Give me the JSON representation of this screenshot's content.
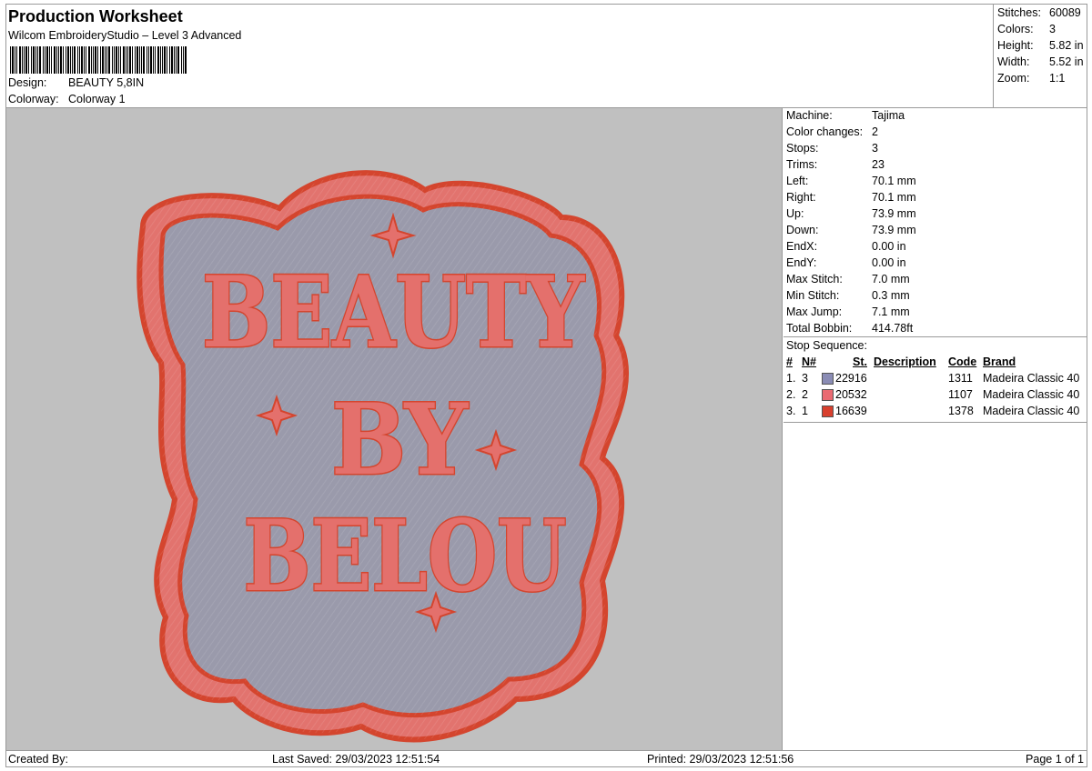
{
  "header": {
    "title": "Production Worksheet",
    "subtitle": "Wilcom EmbroideryStudio – Level 3 Advanced",
    "design_label": "Design:",
    "design_value": "BEAUTY 5,8IN",
    "colorway_label": "Colorway:",
    "colorway_value": "Colorway 1"
  },
  "stats": [
    {
      "label": "Stitches:",
      "value": "60089"
    },
    {
      "label": "Colors:",
      "value": "3"
    },
    {
      "label": "Height:",
      "value": "5.82 in"
    },
    {
      "label": "Width:",
      "value": "5.52 in"
    },
    {
      "label": "Zoom:",
      "value": "1:1"
    }
  ],
  "machine_info": [
    {
      "label": "Machine:",
      "value": "Tajima"
    },
    {
      "label": "Color changes:",
      "value": "2"
    },
    {
      "label": "Stops:",
      "value": "3"
    },
    {
      "label": "Trims:",
      "value": "23"
    },
    {
      "label": "Left:",
      "value": "70.1 mm"
    },
    {
      "label": "Right:",
      "value": "70.1 mm"
    },
    {
      "label": "Up:",
      "value": "73.9 mm"
    },
    {
      "label": "Down:",
      "value": "73.9 mm"
    },
    {
      "label": "EndX:",
      "value": "0.00 in"
    },
    {
      "label": "EndY:",
      "value": "0.00 in"
    },
    {
      "label": "Max Stitch:",
      "value": "7.0 mm"
    },
    {
      "label": "Min Stitch:",
      "value": "0.3 mm"
    },
    {
      "label": "Max Jump:",
      "value": "7.1 mm"
    },
    {
      "label": "Total Bobbin:",
      "value": "414.78ft"
    }
  ],
  "stop_sequence": {
    "title": "Stop Sequence:",
    "headers": {
      "num": "#",
      "n": "N#",
      "st": "St.",
      "desc": "Description",
      "code": "Code",
      "brand": "Brand"
    },
    "rows": [
      {
        "num": "1.",
        "n": "3",
        "color": "#8a8cb5",
        "st": "22916",
        "desc": "",
        "code": "1311",
        "brand": "Madeira Classic 40"
      },
      {
        "num": "2.",
        "n": "2",
        "color": "#ea6a72",
        "st": "20532",
        "desc": "",
        "code": "1107",
        "brand": "Madeira Classic 40"
      },
      {
        "num": "3.",
        "n": "1",
        "color": "#d8402e",
        "st": "16639",
        "desc": "",
        "code": "1378",
        "brand": "Madeira Classic 40"
      }
    ]
  },
  "design_preview": {
    "lines": [
      "BEAUTY",
      "BY",
      "BELOU"
    ],
    "colors": {
      "background": "#c0c0c0",
      "fill": "#9a9aab",
      "border": "#e2736e",
      "outline": "#d4452e",
      "letters": "#e4706c"
    }
  },
  "footer": {
    "created_by": "Created By:",
    "last_saved": "Last Saved: 29/03/2023 12:51:54",
    "printed": "Printed: 29/03/2023 12:51:56",
    "page": "Page 1 of 1"
  }
}
